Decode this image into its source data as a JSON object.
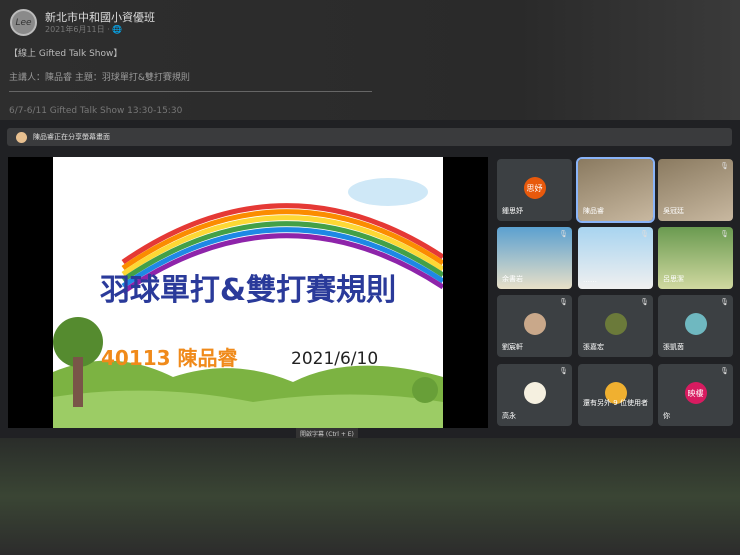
{
  "post": {
    "page_name": "新北市中和國小資優班",
    "date": "2021年6月11日 · 🌐",
    "line1": "【線上 Gifted Talk Show】",
    "line2": "主講人：陳品睿 主題：羽球單打&雙打賽規則",
    "line3": "6/7-6/11 Gifted Talk Show 13:30-15:30"
  },
  "meet": {
    "sharing": "陳品睿正在分享螢幕畫面",
    "caption_hint": "開啟字幕 (Ctrl + E)",
    "slide": {
      "title": "羽球單打&雙打賽規則",
      "presenter": "40113 陳品睿",
      "date": "2021/6/10"
    },
    "tiles": [
      {
        "name": "鍾思妤",
        "initials": "思妤",
        "color": "#e8590c"
      },
      {
        "name": "陳品睿"
      },
      {
        "name": "吳冠廷"
      },
      {
        "name": "余書岩"
      },
      {
        "name": "……"
      },
      {
        "name": "呂思潔"
      },
      {
        "name": "劉宸軒"
      },
      {
        "name": "張嘉宏"
      },
      {
        "name": "張凱茵"
      },
      {
        "name": "高永"
      },
      {
        "name": "還有另外 9 位使用者"
      },
      {
        "name": "你",
        "initials": "映樓",
        "color": "#d81b60"
      }
    ]
  }
}
